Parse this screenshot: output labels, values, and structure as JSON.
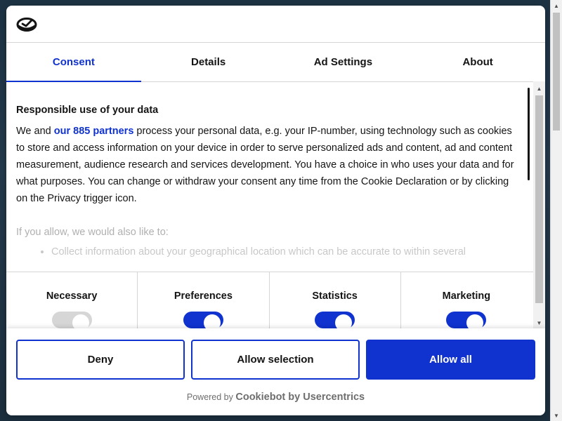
{
  "tabs": [
    {
      "label": "Consent",
      "active": true
    },
    {
      "label": "Details",
      "active": false
    },
    {
      "label": "Ad Settings",
      "active": false
    },
    {
      "label": "About",
      "active": false
    }
  ],
  "content": {
    "heading": "Responsible use of your data",
    "intro_prefix": "We and ",
    "partners_link": "our 885 partners",
    "intro_suffix": " process your personal data, e.g. your IP-number, using technology such as cookies to store and access information on your device in order to serve personalized ads and content, ad and content measurement, audience research and services development. You have a choice in who uses your data and for what purposes. You can change or withdraw your consent any time from the Cookie Declaration or by clicking on the Privacy trigger icon.",
    "allow_intro": "If you allow, we would also like to:",
    "allow_items": [
      "Collect information about your geographical location which can be accurate to within several"
    ]
  },
  "toggles": [
    {
      "label": "Necessary",
      "state": "disabled"
    },
    {
      "label": "Preferences",
      "state": "on"
    },
    {
      "label": "Statistics",
      "state": "on"
    },
    {
      "label": "Marketing",
      "state": "on"
    }
  ],
  "buttons": {
    "deny": "Deny",
    "allow_selection": "Allow selection",
    "allow_all": "Allow all"
  },
  "footer": {
    "powered_by": "Powered by",
    "brand": "Cookiebot by Usercentrics"
  },
  "colors": {
    "accent": "#1032cf",
    "text": "#141414",
    "toggle_disabled": "#d6d6d6"
  },
  "icons": {
    "logo": "cookiebot-logo-icon"
  }
}
